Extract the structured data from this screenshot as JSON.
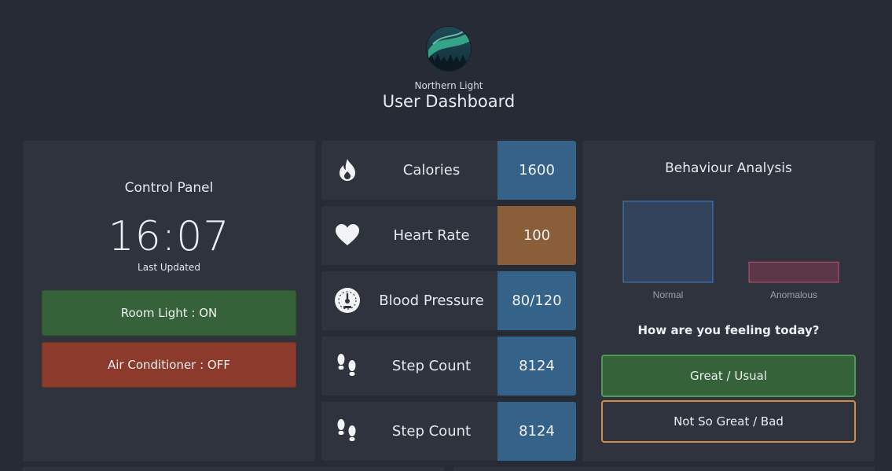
{
  "header": {
    "subtitle": "Northern Light",
    "title": "User Dashboard"
  },
  "control_panel": {
    "title": "Control Panel",
    "time": "16:07",
    "time_caption": "Last Updated",
    "room_light_label": "Room Light : ON",
    "ac_label": "Air Conditioner : OFF",
    "colors": {
      "on": "#356239",
      "off": "#8b3a2b"
    }
  },
  "metrics": [
    {
      "icon": "flame-icon",
      "label": "Calories",
      "value": "1600",
      "color": "#356289"
    },
    {
      "icon": "heart-icon",
      "label": "Heart Rate",
      "value": "100",
      "color": "#8a5e38"
    },
    {
      "icon": "gauge-icon",
      "label": "Blood Pressure",
      "value": "80/120",
      "color": "#356289"
    },
    {
      "icon": "footsteps-icon",
      "label": "Step Count",
      "value": "8124",
      "color": "#356289"
    },
    {
      "icon": "footsteps-icon",
      "label": "Step Count",
      "value": "8124",
      "color": "#356289"
    }
  ],
  "behaviour": {
    "title": "Behaviour Analysis",
    "question": "How are you feeling today?",
    "great_label": "Great / Usual",
    "not_great_label": "Not So Great / Bad"
  },
  "chart_data": {
    "type": "bar",
    "categories": [
      "Normal",
      "Anomalous"
    ],
    "values": [
      100,
      25
    ],
    "ylim": [
      0,
      100
    ],
    "grid": false,
    "colors": [
      {
        "fill": "#32435b",
        "stroke": "#3b7fc4"
      },
      {
        "fill": "#5a3848",
        "stroke": "#c2506e"
      }
    ]
  }
}
